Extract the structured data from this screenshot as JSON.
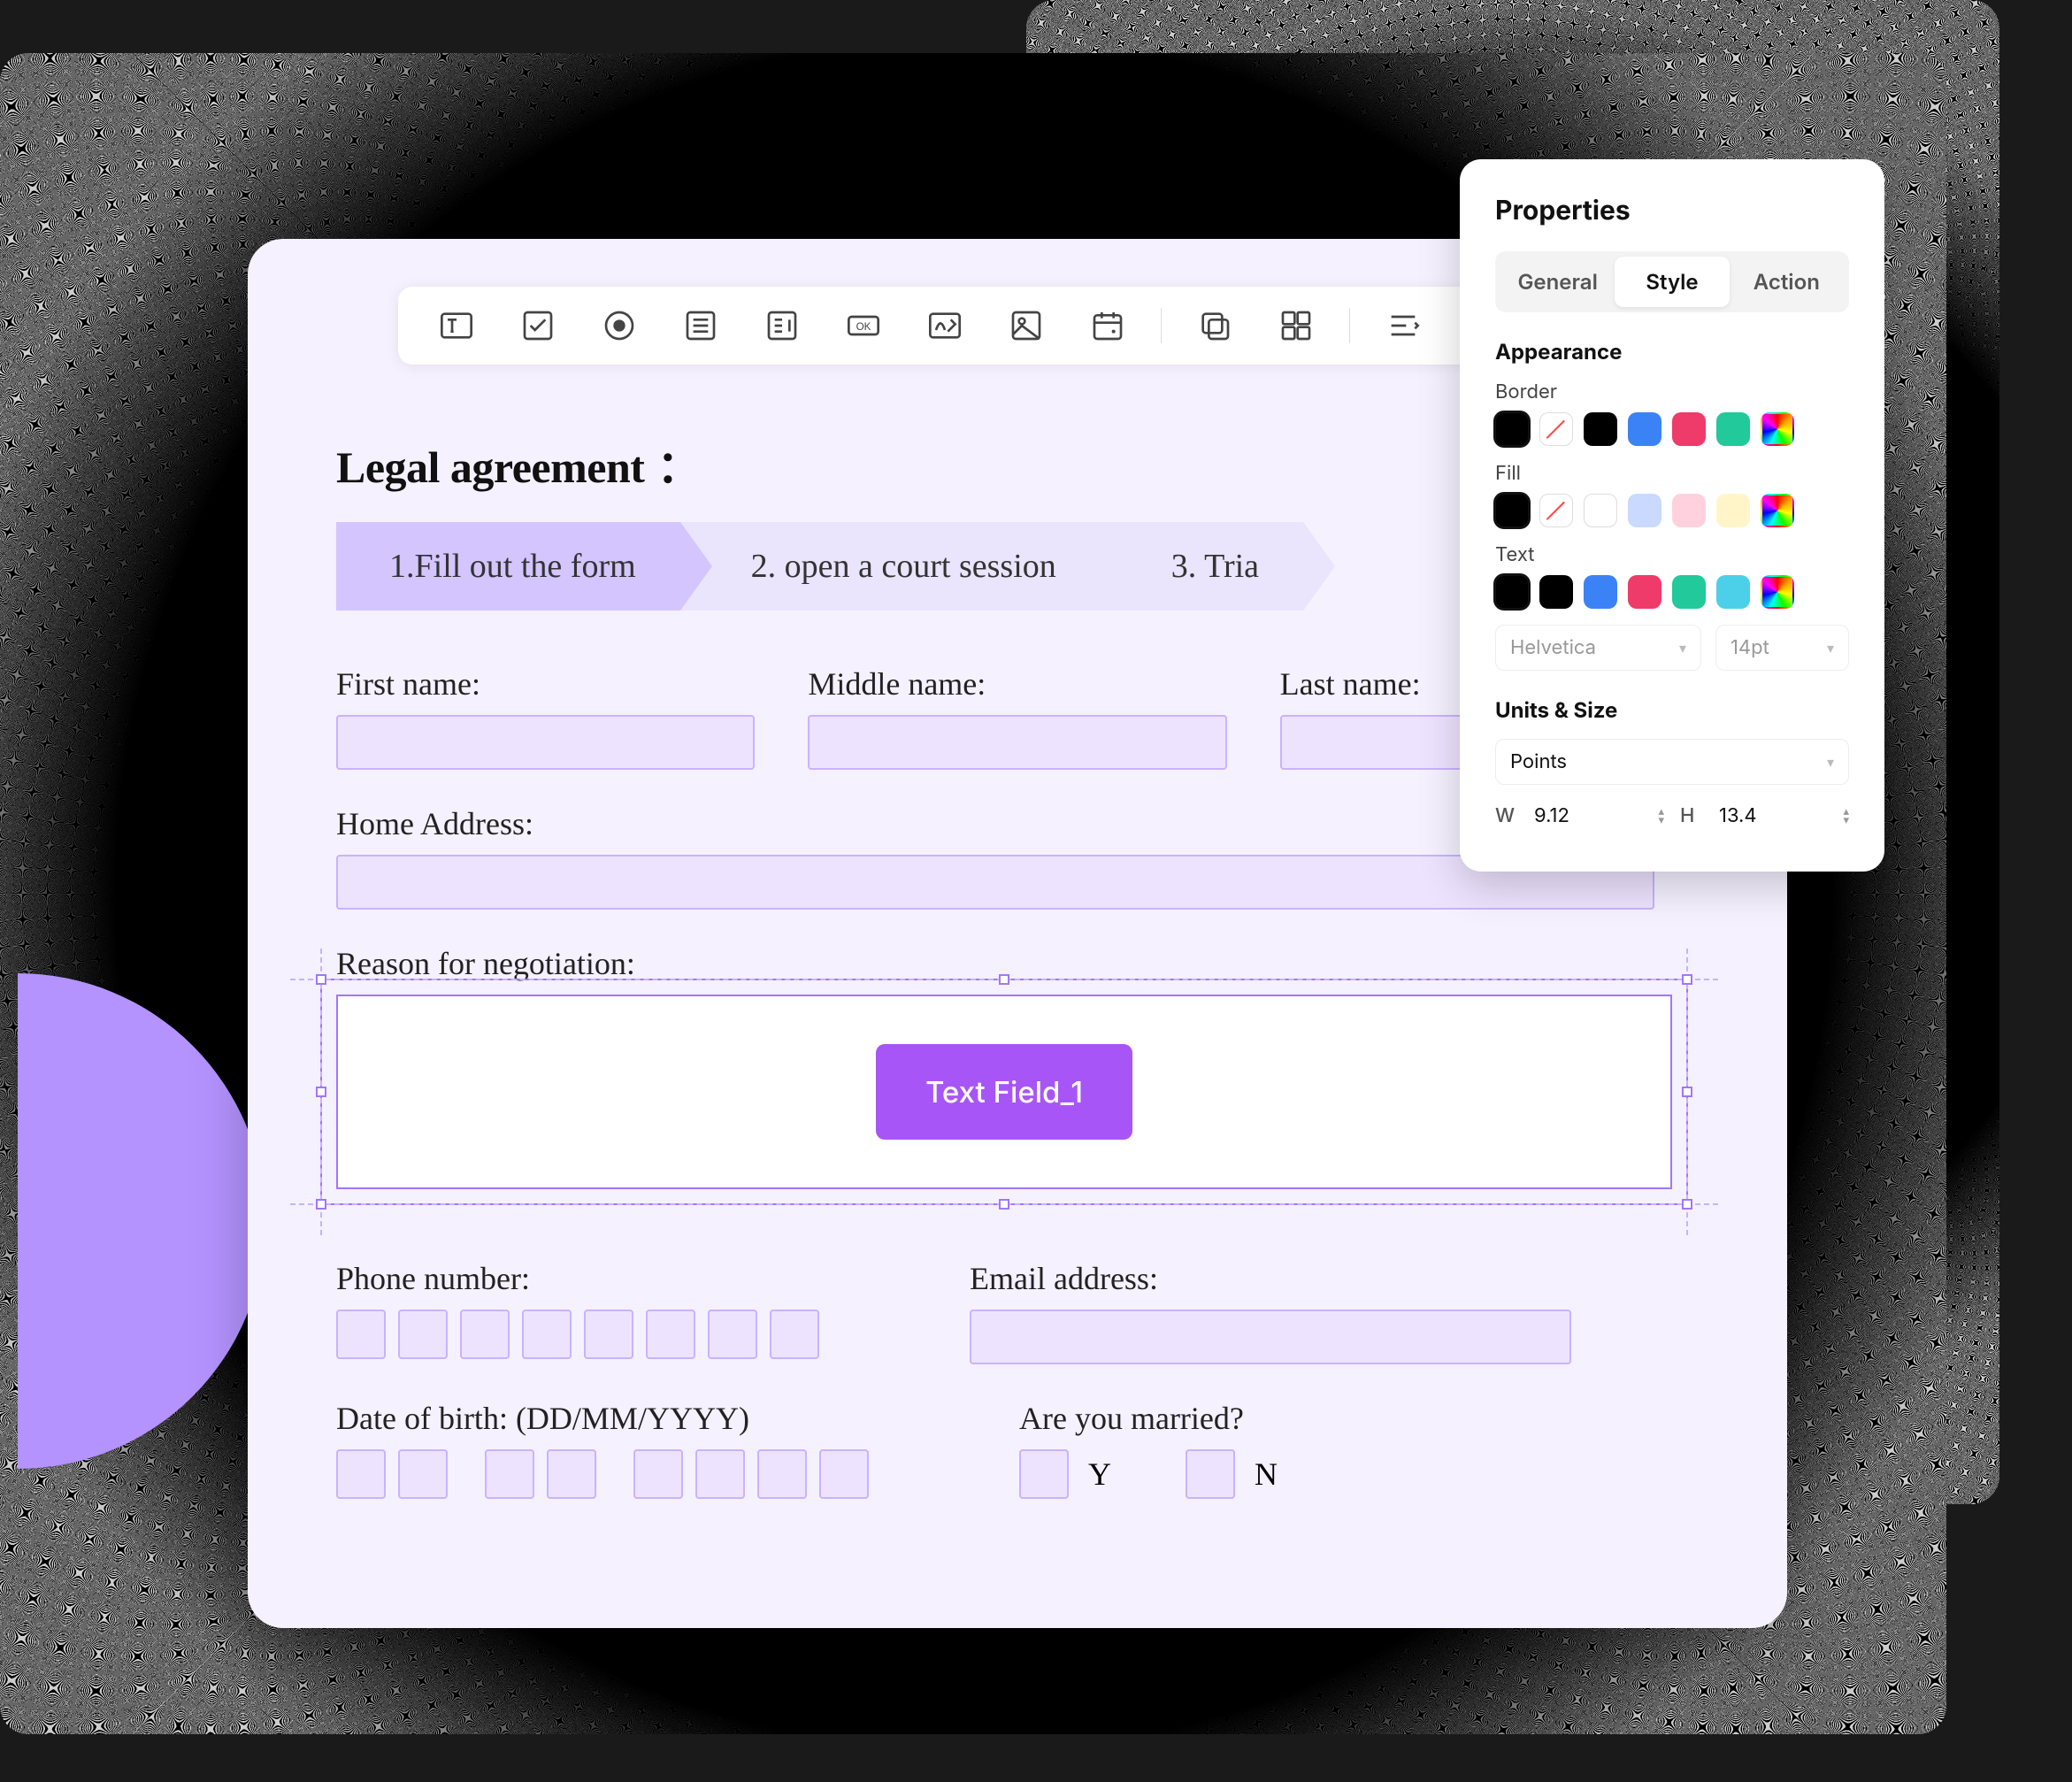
{
  "properties": {
    "title": "Properties",
    "tabs": {
      "general": "General",
      "style": "Style",
      "action": "Action"
    },
    "appearance": {
      "title": "Appearance",
      "border_label": "Border",
      "fill_label": "Fill",
      "text_label": "Text",
      "border_colors": [
        "#000000",
        "none",
        "#000000",
        "#3b82f6",
        "#ef3b6a",
        "#22c99a",
        "rainbow"
      ],
      "fill_colors": [
        "#000000",
        "none",
        "white",
        "#c9d9ff",
        "#ffd1df",
        "#fff5c9",
        "rainbow"
      ],
      "text_colors": [
        "#000000",
        "#000000",
        "#3b82f6",
        "#ef3b6a",
        "#22c99a",
        "#4cd0ea",
        "rainbow"
      ],
      "font_family": "Helvetica",
      "font_size": "14pt"
    },
    "units": {
      "title": "Units & Size",
      "unit": "Points",
      "w_label": "W",
      "w_value": "9.12",
      "h_label": "H",
      "h_value": "13.4"
    }
  },
  "form": {
    "title": "Legal agreement",
    "title_colon": "：",
    "wizard": {
      "step1": "1.Fill out the form",
      "step2": "2. open a court session",
      "step3": "3. Tria"
    },
    "fields": {
      "first_name": "First name:",
      "middle_name": "Middle name:",
      "last_name": "Last name:",
      "home_address": "Home Address:",
      "reason": "Reason for negotiation:",
      "selected_field_name": "Text Field_1",
      "phone": "Phone number:",
      "email": "Email address:",
      "dob": "Date of birth: (DD/MM/YYYY)",
      "married": "Are you married?",
      "yes": "Y",
      "no": "N"
    }
  }
}
